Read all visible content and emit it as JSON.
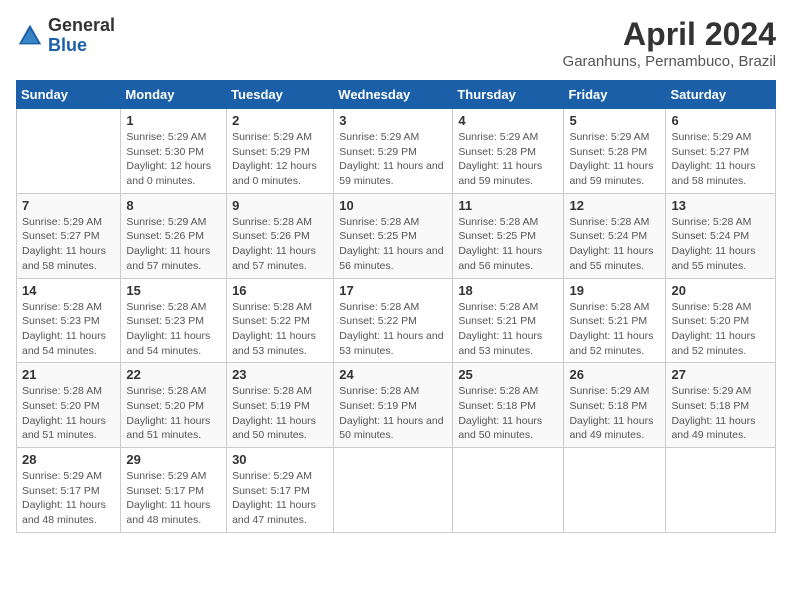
{
  "logo": {
    "general": "General",
    "blue": "Blue"
  },
  "title": "April 2024",
  "subtitle": "Garanhuns, Pernambuco, Brazil",
  "weekdays": [
    "Sunday",
    "Monday",
    "Tuesday",
    "Wednesday",
    "Thursday",
    "Friday",
    "Saturday"
  ],
  "weeks": [
    [
      null,
      {
        "day": "1",
        "sunrise": "5:29 AM",
        "sunset": "5:30 PM",
        "daylight": "12 hours and 0 minutes."
      },
      {
        "day": "2",
        "sunrise": "5:29 AM",
        "sunset": "5:29 PM",
        "daylight": "12 hours and 0 minutes."
      },
      {
        "day": "3",
        "sunrise": "5:29 AM",
        "sunset": "5:29 PM",
        "daylight": "11 hours and 59 minutes."
      },
      {
        "day": "4",
        "sunrise": "5:29 AM",
        "sunset": "5:28 PM",
        "daylight": "11 hours and 59 minutes."
      },
      {
        "day": "5",
        "sunrise": "5:29 AM",
        "sunset": "5:28 PM",
        "daylight": "11 hours and 59 minutes."
      },
      {
        "day": "6",
        "sunrise": "5:29 AM",
        "sunset": "5:27 PM",
        "daylight": "11 hours and 58 minutes."
      }
    ],
    [
      {
        "day": "7",
        "sunrise": "5:29 AM",
        "sunset": "5:27 PM",
        "daylight": "11 hours and 58 minutes."
      },
      {
        "day": "8",
        "sunrise": "5:29 AM",
        "sunset": "5:26 PM",
        "daylight": "11 hours and 57 minutes."
      },
      {
        "day": "9",
        "sunrise": "5:28 AM",
        "sunset": "5:26 PM",
        "daylight": "11 hours and 57 minutes."
      },
      {
        "day": "10",
        "sunrise": "5:28 AM",
        "sunset": "5:25 PM",
        "daylight": "11 hours and 56 minutes."
      },
      {
        "day": "11",
        "sunrise": "5:28 AM",
        "sunset": "5:25 PM",
        "daylight": "11 hours and 56 minutes."
      },
      {
        "day": "12",
        "sunrise": "5:28 AM",
        "sunset": "5:24 PM",
        "daylight": "11 hours and 55 minutes."
      },
      {
        "day": "13",
        "sunrise": "5:28 AM",
        "sunset": "5:24 PM",
        "daylight": "11 hours and 55 minutes."
      }
    ],
    [
      {
        "day": "14",
        "sunrise": "5:28 AM",
        "sunset": "5:23 PM",
        "daylight": "11 hours and 54 minutes."
      },
      {
        "day": "15",
        "sunrise": "5:28 AM",
        "sunset": "5:23 PM",
        "daylight": "11 hours and 54 minutes."
      },
      {
        "day": "16",
        "sunrise": "5:28 AM",
        "sunset": "5:22 PM",
        "daylight": "11 hours and 53 minutes."
      },
      {
        "day": "17",
        "sunrise": "5:28 AM",
        "sunset": "5:22 PM",
        "daylight": "11 hours and 53 minutes."
      },
      {
        "day": "18",
        "sunrise": "5:28 AM",
        "sunset": "5:21 PM",
        "daylight": "11 hours and 53 minutes."
      },
      {
        "day": "19",
        "sunrise": "5:28 AM",
        "sunset": "5:21 PM",
        "daylight": "11 hours and 52 minutes."
      },
      {
        "day": "20",
        "sunrise": "5:28 AM",
        "sunset": "5:20 PM",
        "daylight": "11 hours and 52 minutes."
      }
    ],
    [
      {
        "day": "21",
        "sunrise": "5:28 AM",
        "sunset": "5:20 PM",
        "daylight": "11 hours and 51 minutes."
      },
      {
        "day": "22",
        "sunrise": "5:28 AM",
        "sunset": "5:20 PM",
        "daylight": "11 hours and 51 minutes."
      },
      {
        "day": "23",
        "sunrise": "5:28 AM",
        "sunset": "5:19 PM",
        "daylight": "11 hours and 50 minutes."
      },
      {
        "day": "24",
        "sunrise": "5:28 AM",
        "sunset": "5:19 PM",
        "daylight": "11 hours and 50 minutes."
      },
      {
        "day": "25",
        "sunrise": "5:28 AM",
        "sunset": "5:18 PM",
        "daylight": "11 hours and 50 minutes."
      },
      {
        "day": "26",
        "sunrise": "5:29 AM",
        "sunset": "5:18 PM",
        "daylight": "11 hours and 49 minutes."
      },
      {
        "day": "27",
        "sunrise": "5:29 AM",
        "sunset": "5:18 PM",
        "daylight": "11 hours and 49 minutes."
      }
    ],
    [
      {
        "day": "28",
        "sunrise": "5:29 AM",
        "sunset": "5:17 PM",
        "daylight": "11 hours and 48 minutes."
      },
      {
        "day": "29",
        "sunrise": "5:29 AM",
        "sunset": "5:17 PM",
        "daylight": "11 hours and 48 minutes."
      },
      {
        "day": "30",
        "sunrise": "5:29 AM",
        "sunset": "5:17 PM",
        "daylight": "11 hours and 47 minutes."
      },
      null,
      null,
      null,
      null
    ]
  ]
}
